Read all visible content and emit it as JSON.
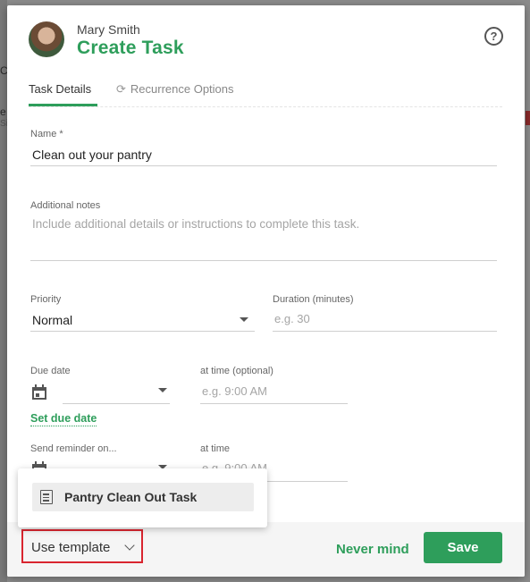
{
  "background": {
    "fragments": [
      "C",
      "e",
      "Si"
    ]
  },
  "header": {
    "user_name": "Mary Smith",
    "title": "Create Task",
    "help_glyph": "?"
  },
  "tabs": [
    {
      "label": "Task Details",
      "active": true
    },
    {
      "label": "Recurrence Options",
      "active": false,
      "icon": "refresh-icon"
    }
  ],
  "form": {
    "name": {
      "label": "Name *",
      "value": "Clean out your pantry"
    },
    "notes": {
      "label": "Additional notes",
      "placeholder": "Include additional details or instructions to complete this task."
    },
    "priority": {
      "label": "Priority",
      "value": "Normal"
    },
    "duration": {
      "label": "Duration (minutes)",
      "placeholder": "e.g. 30"
    },
    "due_date": {
      "label": "Due date",
      "icon": "calendar-icon",
      "value": ""
    },
    "due_time": {
      "label": "at time (optional)",
      "placeholder": "e.g. 9:00 AM"
    },
    "set_due_link": "Set due date",
    "reminder": {
      "label": "Send reminder on...",
      "icon": "calendar-icon"
    },
    "reminder_time": {
      "label": "at time",
      "placeholder": "e.g. 9:00 AM"
    }
  },
  "template_menu": {
    "items": [
      {
        "label": "Pantry Clean Out Task",
        "icon": "document-icon"
      }
    ]
  },
  "footer": {
    "use_template": "Use template",
    "never_mind": "Never mind",
    "save": "Save"
  },
  "colors": {
    "accent": "#2e9e5b",
    "highlight_border": "#d9252f"
  }
}
